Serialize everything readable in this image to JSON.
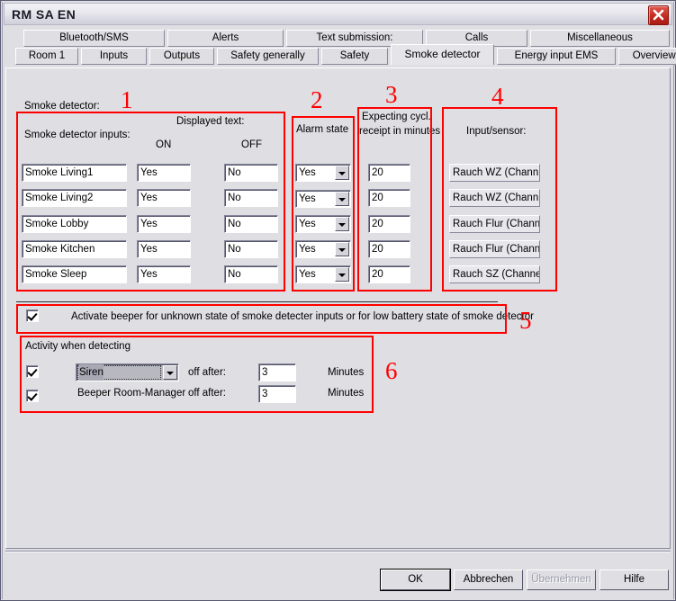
{
  "window": {
    "title": "RM SA EN",
    "close_icon": "close-icon"
  },
  "tabs": {
    "row1": [
      {
        "label": "Bluetooth/SMS"
      },
      {
        "label": "Alerts"
      },
      {
        "label": "Text submission:"
      },
      {
        "label": "Calls"
      },
      {
        "label": "Miscellaneous"
      }
    ],
    "row2": [
      {
        "label": "Room 1"
      },
      {
        "label": "Inputs"
      },
      {
        "label": "Outputs"
      },
      {
        "label": "Safety generally"
      },
      {
        "label": "Safety"
      },
      {
        "label": "Smoke detector",
        "active": true
      },
      {
        "label": "Energy input EMS"
      },
      {
        "label": "Overview Energy"
      }
    ]
  },
  "page": {
    "section_title": "Smoke detector:",
    "inputs_group": {
      "heading": "Smoke detector inputs:",
      "displayed_text_label": "Displayed text:",
      "on_label": "ON",
      "off_label": "OFF",
      "rows": [
        {
          "name": "Smoke Living1",
          "on": "Yes",
          "off": "No"
        },
        {
          "name": "Smoke Living2",
          "on": "Yes",
          "off": "No"
        },
        {
          "name": "Smoke Lobby",
          "on": "Yes",
          "off": "No"
        },
        {
          "name": "Smoke Kitchen",
          "on": "Yes",
          "off": "No"
        },
        {
          "name": "Smoke Sleep",
          "on": "Yes",
          "off": "No"
        }
      ]
    },
    "alarm_state_group": {
      "heading": "Alarm state",
      "values": [
        "Yes",
        "Yes",
        "Yes",
        "Yes",
        "Yes"
      ]
    },
    "cyclical_group": {
      "heading_line1": "Expecting cycl.",
      "heading_line2": "receipt in minutes",
      "values": [
        "20",
        "20",
        "20",
        "20",
        "20"
      ]
    },
    "sensor_group": {
      "heading": "Input/sensor:",
      "values": [
        "Rauch WZ  (Chann",
        "Rauch WZ  (Chann",
        "Rauch Flur  (Channe",
        "Rauch Flur  (Channe",
        "Rauch SZ  (Channel"
      ]
    },
    "beeper_row": {
      "checked": true,
      "label": "Activate beeper for unknown state of smoke detecter inputs or for low battery state of smoke detector"
    },
    "activity_group": {
      "legend": "Activity when detecting",
      "rows": [
        {
          "checked": true,
          "type": "combo",
          "value": "Siren",
          "off_after_label": "off after:",
          "minutes_value": "3",
          "minutes_label": "Minutes"
        },
        {
          "checked": true,
          "type": "label",
          "value": "Beeper Room-Manager",
          "off_after_label": "off after:",
          "minutes_value": "3",
          "minutes_label": "Minutes"
        }
      ]
    }
  },
  "annotations": [
    {
      "number": "1"
    },
    {
      "number": "2"
    },
    {
      "number": "3"
    },
    {
      "number": "4"
    },
    {
      "number": "5"
    },
    {
      "number": "6"
    }
  ],
  "buttons": {
    "ok": "OK",
    "cancel": "Abbrechen",
    "apply": "Übernehmen",
    "help": "Hilfe"
  },
  "colors": {
    "annotation": "#ff0000",
    "window_bg": "#dedee3",
    "field_bg": "#ffffff"
  }
}
